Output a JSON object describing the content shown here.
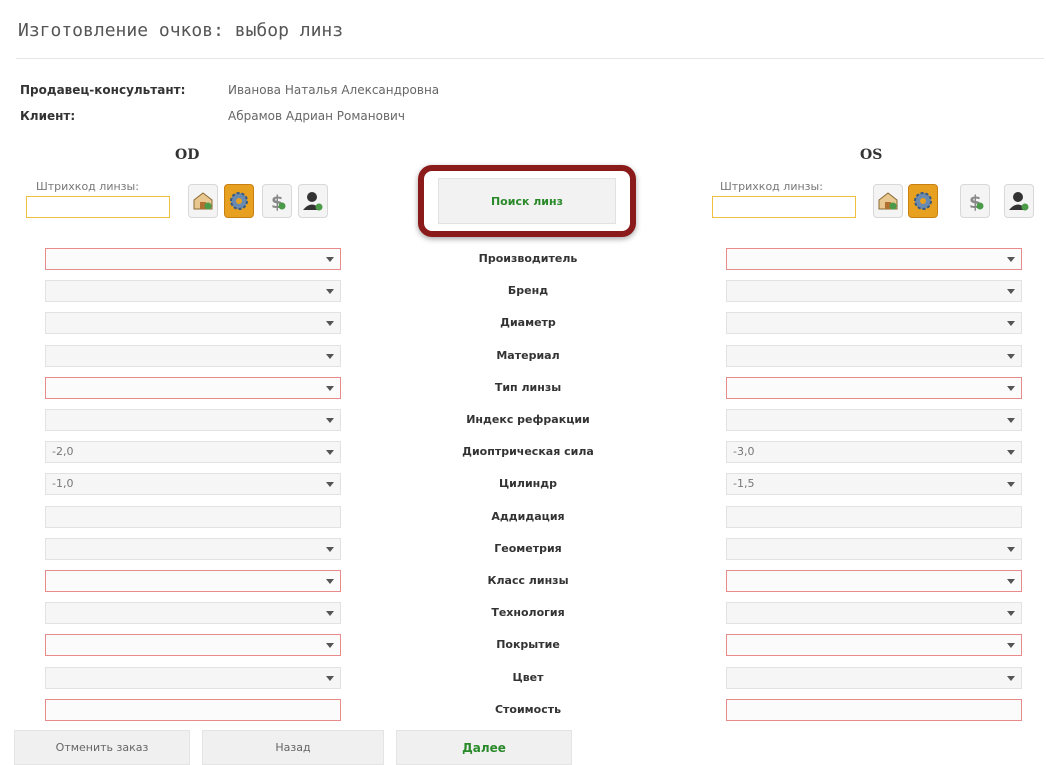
{
  "page": {
    "title": "Изготовление очков: выбор линз"
  },
  "info": {
    "seller_label": "Продавец-консультант:",
    "seller_value": "Иванова Наталья Александровна",
    "client_label": "Клиент:",
    "client_value": "Абрамов Адриан Романович"
  },
  "od": {
    "title": "OD",
    "barcode_label": "Штрихкод линзы:",
    "barcode_value": "",
    "values": [
      "",
      "",
      "",
      "",
      "",
      "",
      "-2,0",
      "-1,0",
      "",
      "",
      "",
      "",
      "",
      "",
      ""
    ]
  },
  "os": {
    "title": "OS",
    "barcode_label": "Штрихкод линзы:",
    "barcode_value": "",
    "values": [
      "",
      "",
      "",
      "",
      "",
      "",
      "-3,0",
      "-1,5",
      "",
      "",
      "",
      "",
      "",
      "",
      ""
    ]
  },
  "search_button": "Поиск линз",
  "rows": {
    "labels": [
      "Производитель",
      "Бренд",
      "Диаметр",
      "Материал",
      "Тип линзы",
      "Индекс рефракции",
      "Диоптрическая сила",
      "Цилиндр",
      "Аддидация",
      "Геометрия",
      "Класс линзы",
      "Технология",
      "Покрытие",
      "Цвет",
      "Стоимость"
    ],
    "required": [
      true,
      false,
      false,
      false,
      true,
      false,
      false,
      false,
      false,
      false,
      true,
      false,
      true,
      false,
      true
    ],
    "is_dropdown": [
      true,
      true,
      true,
      true,
      true,
      true,
      true,
      true,
      false,
      true,
      true,
      true,
      true,
      true,
      false
    ]
  },
  "icons": [
    "warehouse-icon",
    "gear-icon",
    "price-icon",
    "person-icon"
  ],
  "footer": {
    "cancel_label": "Отменить заказ",
    "back_label": "Назад",
    "next_label": "Далее"
  },
  "colors": {
    "required_border": "#e88a8a",
    "barcode_border": "#f0c040",
    "search_highlight": "#8b1a1a",
    "primary_text": "#2a8a2a",
    "active_icon": "#e8a020"
  }
}
